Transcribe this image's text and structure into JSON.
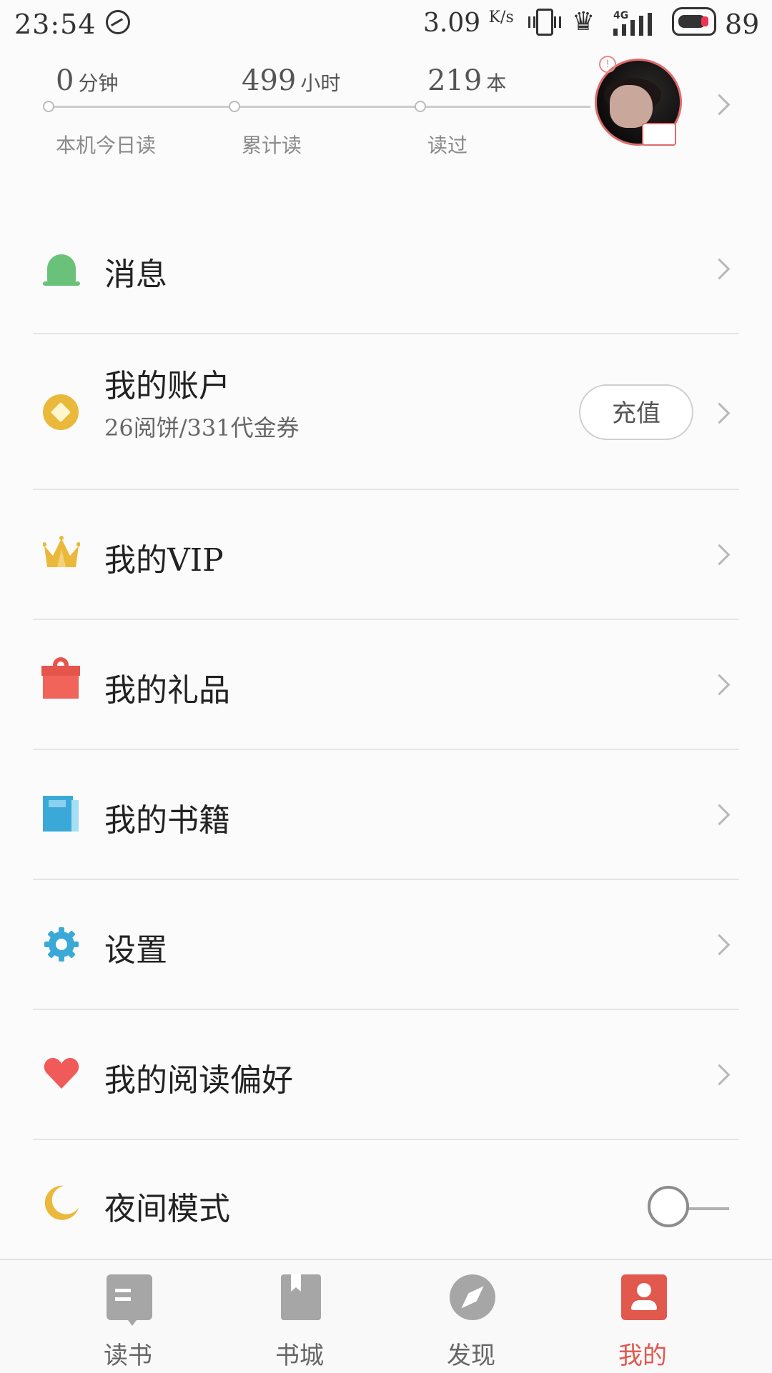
{
  "status_bar": {
    "time": "23:54",
    "speed": "3.09",
    "speed_unit": "K/s",
    "network": "4G",
    "battery": "89"
  },
  "stats": {
    "today": {
      "value": "0",
      "unit": "分钟",
      "label": "本机今日读"
    },
    "total": {
      "value": "499",
      "unit": "小时",
      "label": "累计读"
    },
    "books": {
      "value": "219",
      "unit": "本",
      "label": "读过"
    }
  },
  "menu": {
    "messages": {
      "title": "消息"
    },
    "account": {
      "title": "我的账户",
      "subtitle": "26阅饼/331代金券",
      "recharge": "充值"
    },
    "vip": {
      "title": "我的VIP"
    },
    "gifts": {
      "title": "我的礼品"
    },
    "books": {
      "title": "我的书籍"
    },
    "settings": {
      "title": "设置"
    },
    "preferences": {
      "title": "我的阅读偏好"
    },
    "night_mode": {
      "title": "夜间模式",
      "enabled": false
    }
  },
  "bottom_nav": {
    "items": [
      {
        "label": "读书",
        "icon": "book-open-icon"
      },
      {
        "label": "书城",
        "icon": "bookmark-book-icon"
      },
      {
        "label": "发现",
        "icon": "compass-icon"
      },
      {
        "label": "我的",
        "icon": "user-icon"
      }
    ],
    "active_index": 3
  },
  "colors": {
    "accent": "#e1584d",
    "bell": "#6ac27a",
    "coin": "#eab83a",
    "gift": "#f0645a",
    "book": "#3ba9d8",
    "heart": "#f05a58"
  }
}
